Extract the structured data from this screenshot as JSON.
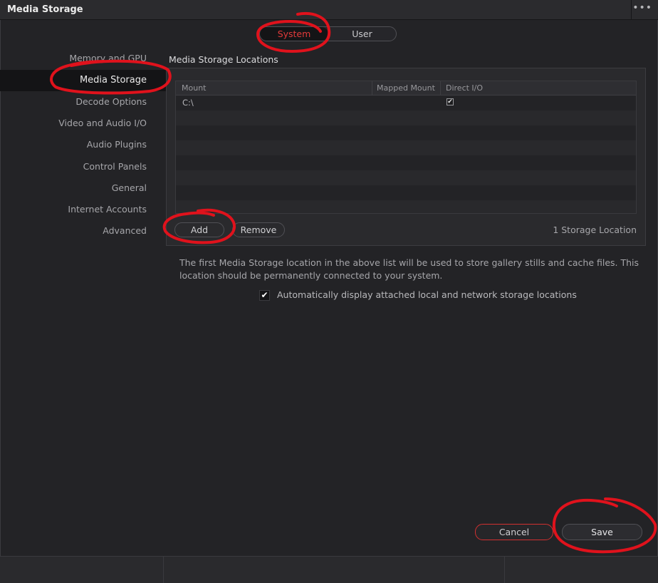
{
  "window": {
    "title": "Media Storage",
    "more_label": "•••"
  },
  "scope_tabs": [
    {
      "label": "System",
      "selected": true
    },
    {
      "label": "User",
      "selected": false
    }
  ],
  "sidebar": {
    "items": [
      {
        "label": "Memory and GPU",
        "active": false
      },
      {
        "label": "Media Storage",
        "active": true
      },
      {
        "label": "Decode Options",
        "active": false
      },
      {
        "label": "Video and Audio I/O",
        "active": false
      },
      {
        "label": "Audio Plugins",
        "active": false
      },
      {
        "label": "Control Panels",
        "active": false
      },
      {
        "label": "General",
        "active": false
      },
      {
        "label": "Internet Accounts",
        "active": false
      },
      {
        "label": "Advanced",
        "active": false
      }
    ]
  },
  "storage": {
    "title": "Media Storage Locations",
    "columns": [
      "Mount",
      "Mapped Mount",
      "Direct I/O"
    ],
    "rows": [
      {
        "mount": "C:\\",
        "mapped_mount": "",
        "direct_io": true
      }
    ],
    "add_label": "Add",
    "remove_label": "Remove",
    "count_label": "1 Storage Location"
  },
  "description": "The first Media Storage location in the above list will be used to store gallery stills and cache files. This location should be permanently connected to your system.",
  "auto_display": {
    "checked": true,
    "label": "Automatically display attached local and network storage locations"
  },
  "footer": {
    "cancel_label": "Cancel",
    "save_label": "Save"
  },
  "colors": {
    "background": "#232326",
    "panel": "#2a2a2d",
    "accent_red": "#e23a3a",
    "annotation": "#e0121c"
  },
  "check_glyph": "✔"
}
